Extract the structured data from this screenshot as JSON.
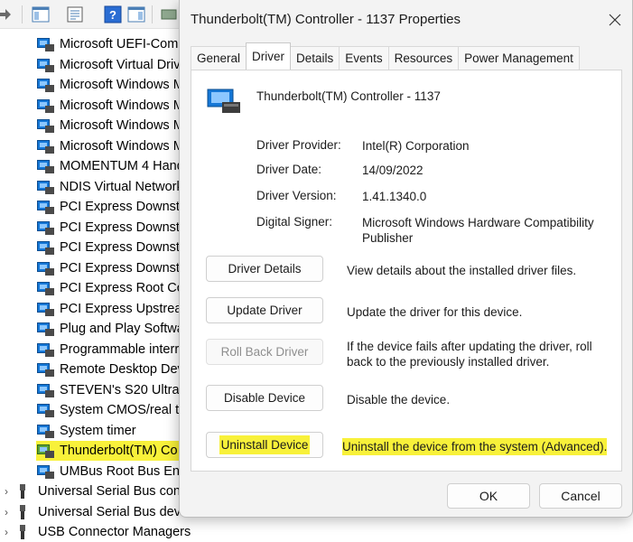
{
  "device_manager": {
    "tree": [
      {
        "label": "Microsoft UEFI-Comp",
        "type": "device"
      },
      {
        "label": "Microsoft Virtual Driv",
        "type": "device"
      },
      {
        "label": "Microsoft Windows M",
        "type": "device"
      },
      {
        "label": "Microsoft Windows M",
        "type": "device"
      },
      {
        "label": "Microsoft Windows M",
        "type": "device"
      },
      {
        "label": "Microsoft Windows M",
        "type": "device"
      },
      {
        "label": "MOMENTUM 4 Hand",
        "type": "device"
      },
      {
        "label": "NDIS Virtual Network",
        "type": "device"
      },
      {
        "label": "PCI Express Downstre",
        "type": "device"
      },
      {
        "label": "PCI Express Downstre",
        "type": "device"
      },
      {
        "label": "PCI Express Downstre",
        "type": "device"
      },
      {
        "label": "PCI Express Downstre",
        "type": "device"
      },
      {
        "label": "PCI Express Root Con",
        "type": "device"
      },
      {
        "label": "PCI Express Upstream",
        "type": "device"
      },
      {
        "label": "Plug and Play Softwa",
        "type": "device"
      },
      {
        "label": "Programmable interr",
        "type": "device"
      },
      {
        "label": "Remote Desktop Dev",
        "type": "device"
      },
      {
        "label": "STEVEN's S20 Ultra H",
        "type": "device"
      },
      {
        "label": "System CMOS/real ti",
        "type": "device"
      },
      {
        "label": "System timer",
        "type": "device"
      },
      {
        "label": "Thunderbolt(TM) Co",
        "type": "device",
        "highlight": true
      },
      {
        "label": "UMBus Root Bus Enu",
        "type": "device"
      },
      {
        "label": "Universal Serial Bus cont",
        "type": "category"
      },
      {
        "label": "Universal Serial Bus devices",
        "type": "category"
      },
      {
        "label": "USB Connector Managers",
        "type": "category"
      }
    ]
  },
  "dialog": {
    "title": "Thunderbolt(TM) Controller - 1137 Properties",
    "tabs": [
      "General",
      "Driver",
      "Details",
      "Events",
      "Resources",
      "Power Management"
    ],
    "active_tab": "Driver",
    "device_name": "Thunderbolt(TM) Controller - 1137",
    "info": {
      "provider_label": "Driver Provider:",
      "provider_value": "Intel(R) Corporation",
      "date_label": "Driver Date:",
      "date_value": "14/09/2022",
      "version_label": "Driver Version:",
      "version_value": "1.41.1340.0",
      "signer_label": "Digital Signer:",
      "signer_value": "Microsoft Windows Hardware Compatibility Publisher"
    },
    "actions": {
      "details_label": "Driver Details",
      "details_desc": "View details about the installed driver files.",
      "update_label": "Update Driver",
      "update_desc": "Update the driver for this device.",
      "rollback_label": "Roll Back Driver",
      "rollback_desc": "If the device fails after updating the driver, roll back to the previously installed driver.",
      "disable_label": "Disable Device",
      "disable_desc": "Disable the device.",
      "uninstall_label": "Uninstall Device",
      "uninstall_desc": "Uninstall the device from the system (Advanced)."
    },
    "ok_label": "OK",
    "cancel_label": "Cancel"
  },
  "colors": {
    "highlight": "#f8f13a",
    "device_icon": "#1577d6"
  }
}
